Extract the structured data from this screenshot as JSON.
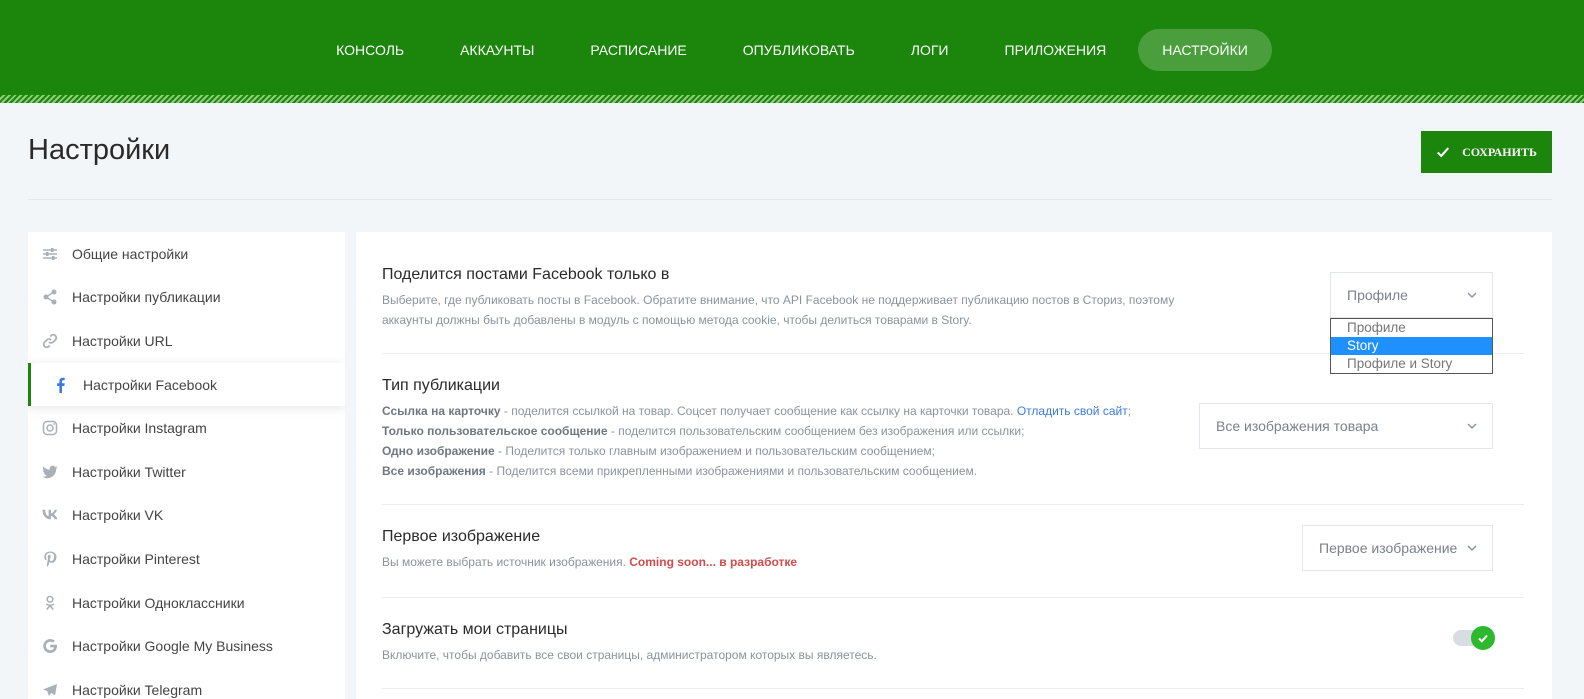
{
  "nav": {
    "items": [
      {
        "label": "КОНСОЛЬ"
      },
      {
        "label": "АККАУНТЫ"
      },
      {
        "label": "РАСПИСАНИЕ"
      },
      {
        "label": "ОПУБЛИКОВАТЬ"
      },
      {
        "label": "ЛОГИ"
      },
      {
        "label": "ПРИЛОЖЕНИЯ"
      },
      {
        "label": "НАСТРОЙКИ"
      }
    ],
    "active_index": 6
  },
  "page": {
    "title": "Настройки",
    "save_label": "СОХРАНИТЬ"
  },
  "sidebar": {
    "items": [
      {
        "label": "Общие настройки",
        "icon": "sliders-icon"
      },
      {
        "label": "Настройки публикации",
        "icon": "share-icon"
      },
      {
        "label": "Настройки URL",
        "icon": "link-icon"
      },
      {
        "label": "Настройки Facebook",
        "icon": "facebook-icon"
      },
      {
        "label": "Настройки Instagram",
        "icon": "instagram-icon"
      },
      {
        "label": "Настройки Twitter",
        "icon": "twitter-icon"
      },
      {
        "label": "Настройки VK",
        "icon": "vk-icon"
      },
      {
        "label": "Настройки Pinterest",
        "icon": "pinterest-icon"
      },
      {
        "label": "Настройки Одноклассники",
        "icon": "odnoklassniki-icon"
      },
      {
        "label": "Настройки Google My Business",
        "icon": "google-icon"
      },
      {
        "label": "Настройки Telegram",
        "icon": "telegram-icon"
      }
    ],
    "active_index": 3
  },
  "sections": {
    "share_to": {
      "title": "Поделится постами Facebook только в",
      "desc_line1": "Выберите, где публиковать посты в Facebook. Обратите внимание, что API Facebook не поддерживает публикацию постов в Сториз, поэтому",
      "desc_line2": "аккаунты должны быть добавлены в модуль с помощью метода cookie, чтобы делиться товарами в Story.",
      "select_value": "Профиле",
      "options": [
        "Профиле",
        "Story",
        "Профиле и Story"
      ],
      "highlighted_option": 1
    },
    "post_type": {
      "title": "Тип публикации",
      "l1_bold": "Ссылка на карточку",
      "l1_text": " - поделится ссылкой на товар. Соцсет получает сообщение как ссылку на карточки товара. ",
      "l1_link": "Отладить свой сайт",
      "l1_end": ";",
      "l2_bold": "Только пользовательское сообщение",
      "l2_text": " - поделится пользовательским сообщением без изображения или ссылки;",
      "l3_bold": "Одно изображение",
      "l3_text": " - Поделится только главным изображением и пользовательским сообщением;",
      "l4_bold": "Все изображения",
      "l4_text": " - Поделится всеми прикрепленными изображениями и пользовательским сообщением.",
      "select_value": "Все изображения товара"
    },
    "first_image": {
      "title": "Первое изображение",
      "desc": "Вы можете выбрать источник изображения. ",
      "soon": "Coming soon... в разработке",
      "select_value": "Первое изображение"
    },
    "load_pages": {
      "title": "Загружать мои страницы",
      "desc": "Включите, чтобы добавить все свои страницы, администратором которых вы являетесь.",
      "enabled": true
    }
  },
  "colors": {
    "brand_green": "#1c850c",
    "active_nav": "#4a9f3c",
    "toggle_on": "#2eb82e",
    "link_blue": "#3b7be0",
    "soon_red": "#d24b4b"
  }
}
